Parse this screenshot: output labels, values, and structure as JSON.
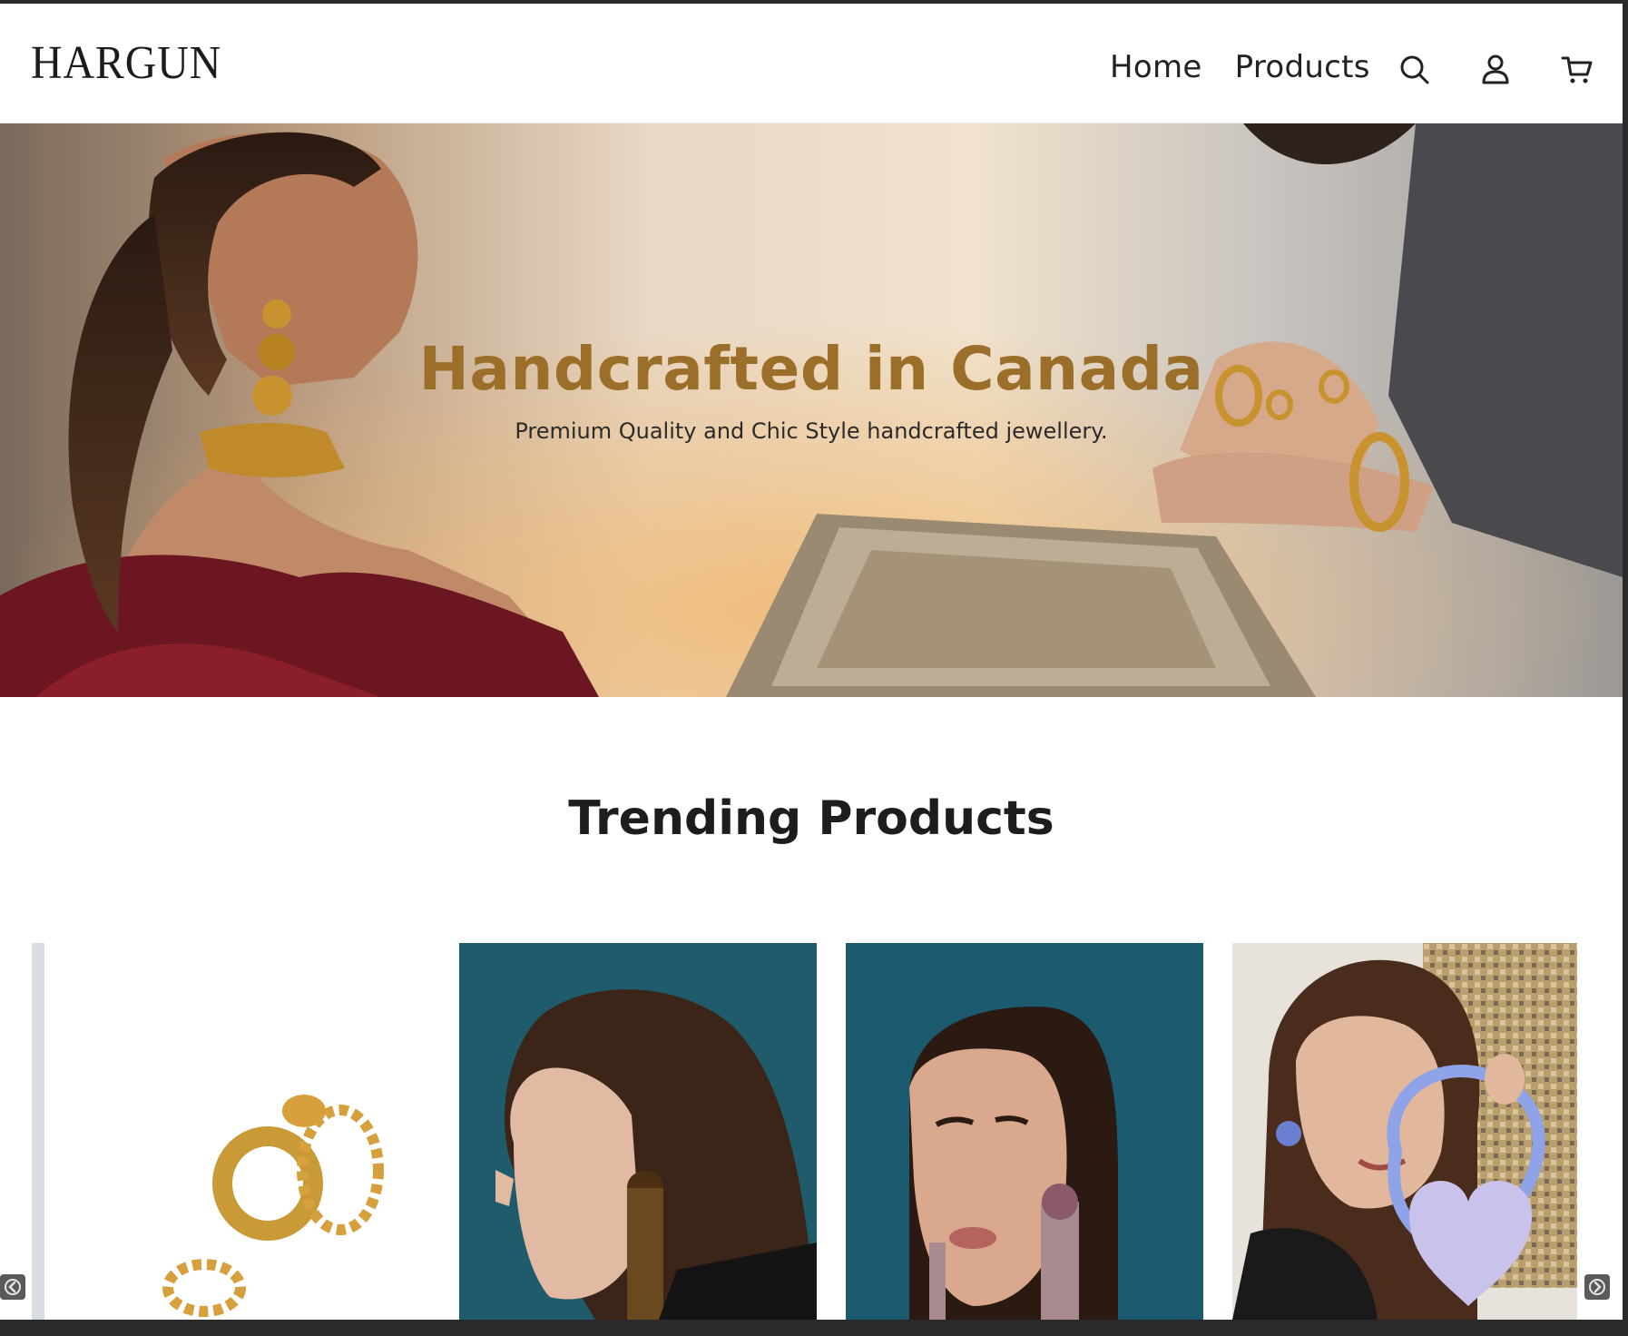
{
  "header": {
    "logo_text": "HARGUN",
    "nav": [
      {
        "label": "Home"
      },
      {
        "label": "Products"
      }
    ],
    "icons": [
      "search-icon",
      "account-icon",
      "cart-icon"
    ]
  },
  "hero": {
    "title": "Handcrafted in Canada",
    "subtitle": "Premium Quality and Chic Style handcrafted jewellery.",
    "title_color": "#9b6f2a"
  },
  "trending": {
    "title": "Trending Products",
    "products": [
      {
        "image": "gold rings on white background"
      },
      {
        "image": "woman profile with gold tassel earring on teal background"
      },
      {
        "image": "woman with pink beaded tassel earring on teal background"
      },
      {
        "image": "smiling woman holding lavender heart bag"
      }
    ],
    "prev_icon": "chevron-left-icon",
    "next_icon": "chevron-right-icon"
  }
}
